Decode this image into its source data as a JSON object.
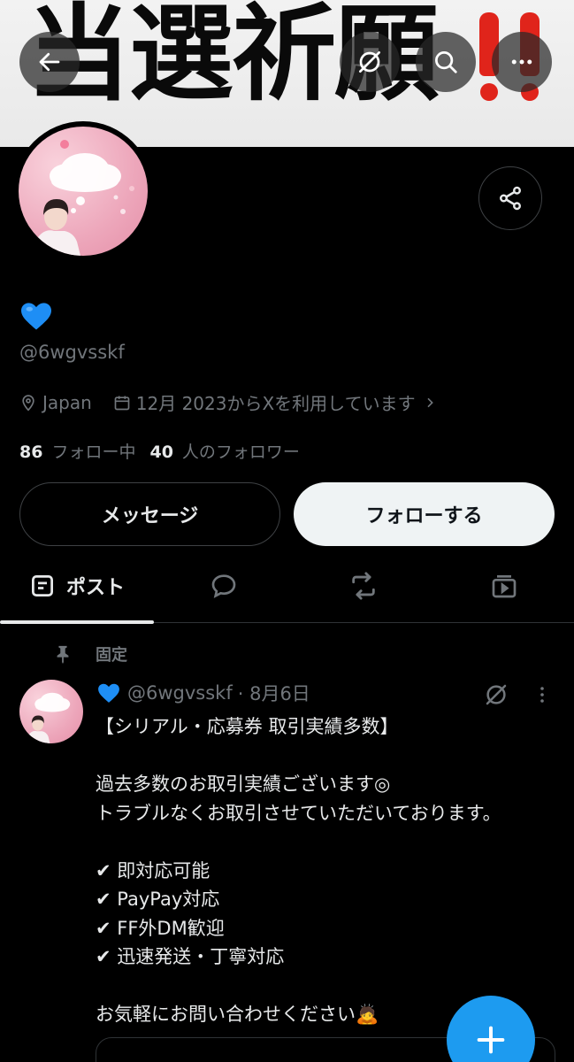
{
  "banner": {
    "text": "当選祈願",
    "accent_color": "#e0241b"
  },
  "top_bar": {
    "back_icon": "arrow-left-icon",
    "grok_icon": "grok-slash-circle-icon",
    "search_icon": "search-icon",
    "more_icon": "more-horizontal-icon"
  },
  "profile": {
    "display_name_icon": "blue-heart-emoji",
    "handle": "@6wgvsskf",
    "location": "Japan",
    "joined": "12月 2023からXを利用しています",
    "following_count": "86",
    "following_label": "フォロー中",
    "followers_count": "40",
    "followers_label": "人のフォロワー"
  },
  "actions": {
    "message_label": "メッセージ",
    "follow_label": "フォローする"
  },
  "tabs": {
    "posts_label": "ポスト",
    "items": [
      "posts-icon",
      "replies-icon",
      "reposts-icon",
      "media-icon"
    ]
  },
  "pinned_post": {
    "pinned_label": "固定",
    "author_handle": "@6wgvsskf",
    "date": "· 8月6日",
    "lines": [
      "【シリアル・応募券 取引実績多数】",
      "",
      "過去多数のお取引実績ございます◎",
      "トラブルなくお取引させていただいております。",
      "",
      "✔ 即対応可能",
      "✔ PayPay対応",
      "✔ FF外DM歓迎",
      "✔ 迅速発送・丁寧対応",
      "",
      "お気軽にお問い合わせください🙇"
    ]
  },
  "fab": {
    "icon": "plus-icon",
    "color": "#1d9bf0"
  }
}
